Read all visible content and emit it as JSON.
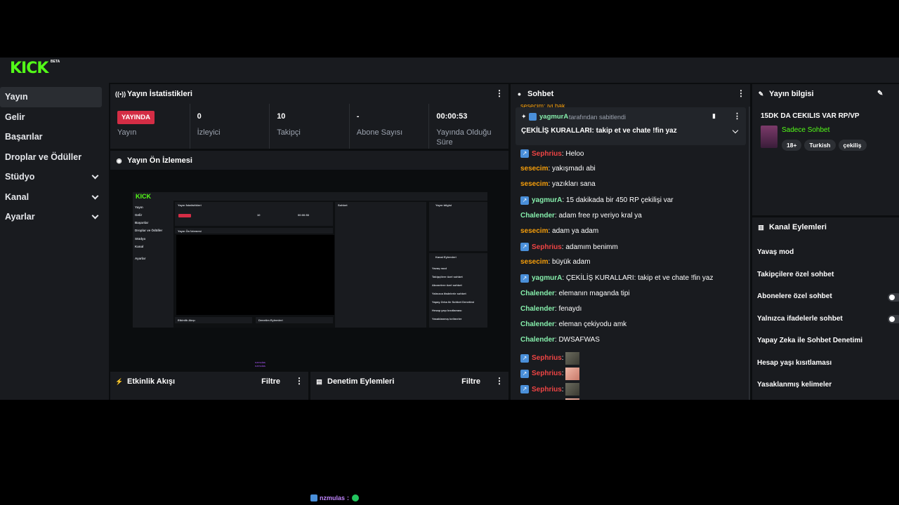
{
  "brand": {
    "logo": "KICK",
    "beta": "BETA"
  },
  "sidebar": {
    "items": [
      {
        "label": "Yayın",
        "active": true,
        "expandable": false
      },
      {
        "label": "Gelir",
        "active": false,
        "expandable": false
      },
      {
        "label": "Başarılar",
        "active": false,
        "expandable": false
      },
      {
        "label": "Droplar ve Ödüller",
        "active": false,
        "expandable": false
      },
      {
        "label": "Stüdyo",
        "active": false,
        "expandable": true
      },
      {
        "label": "Kanal",
        "active": false,
        "expandable": true
      },
      {
        "label": "Ayarlar",
        "active": false,
        "expandable": true
      }
    ]
  },
  "stats_panel": {
    "title": "Yayın İstatistikleri",
    "live_badge": "YAYINDA",
    "stream_label": "Yayın",
    "cells": [
      {
        "value": "0",
        "label": "İzleyici"
      },
      {
        "value": "10",
        "label": "Takipçi"
      },
      {
        "value": "-",
        "label": "Abone Sayısı"
      },
      {
        "value": "00:00:53",
        "label": "Yayında Olduğu Süre"
      }
    ]
  },
  "preview_panel": {
    "title": "Yayın Ön İzlemesi",
    "mini": {
      "logo": "KICK",
      "nav": [
        "Yayın",
        "Gelir",
        "Başarılar",
        "Droplar ve Ödüller",
        "Stüdyo",
        "Kanal",
        "Ayarlar"
      ],
      "stats_title": "Yayın İstatistikleri",
      "chat_title": "Sohbet",
      "info_title": "Yayın bilgisi",
      "preview_title": "Yayın Ön İzlemesi",
      "actions_title": "Kanal Eylemleri",
      "actions": [
        "Yavaş mod",
        "Takipçilere özel sohbet",
        "Abonelere özel sohbet",
        "Yalnızca ifadelerle sohbet",
        "Yapay Zeka ile Sohbet Denetimi",
        "Hesap yaşı kısıtlaması",
        "Yasaklanmış kelimeler"
      ],
      "activity": "Etkinlik Akışı",
      "moderation": "Denetim Eylemleri",
      "filter": "Filtre",
      "badge": "YAYINDA",
      "stat_labels": [
        "Yayın",
        "İzleyici",
        "Takipçi",
        "Abone Sayısı",
        "Yayında Olduğu Süre"
      ],
      "stat_values": [
        "10",
        "00:00:53"
      ],
      "legend": [
        "nzmulas",
        "nzmulas"
      ]
    }
  },
  "activity_panel": {
    "title": "Etkinlik Akışı",
    "filter": "Filtre"
  },
  "moderation_panel": {
    "title": "Denetim Eylemleri",
    "filter": "Filtre"
  },
  "chat": {
    "title": "Sohbet",
    "cut_top": "sesecim: iyi bak",
    "pinned": {
      "user": "yagmurA",
      "note": "tarafından sabitlendi",
      "text": "ÇEKİLİŞ KURALLARI: takip et ve chate !fin yaz"
    },
    "messages": [
      {
        "user": "Sephrius",
        "text": ": Heloo",
        "badge": true,
        "color": "#ef4444"
      },
      {
        "user": "sesecim",
        "text": ": yakışmadı abi",
        "badge": false,
        "color": "#f59e0b"
      },
      {
        "user": "sesecim",
        "text": ": yazıkları sana",
        "badge": false,
        "color": "#f59e0b"
      },
      {
        "user": "yagmurA",
        "text": ": 15 dakikada bir 450 RP çekilişi var",
        "badge": true,
        "color": "#86efac"
      },
      {
        "user": "Chalender",
        "text": ": adam free rp veriyo kral ya",
        "badge": false,
        "color": "#86efac"
      },
      {
        "user": "sesecim",
        "text": ": adam ya adam",
        "badge": false,
        "color": "#f59e0b"
      },
      {
        "user": "Sephrius",
        "text": ": adamım benimm",
        "badge": true,
        "color": "#ef4444"
      },
      {
        "user": "sesecim",
        "text": ": büyük adam",
        "badge": false,
        "color": "#f59e0b"
      },
      {
        "user": "yagmurA",
        "text": ": ÇEKİLİŞ KURALLARI: takip et ve chate !fin yaz",
        "badge": true,
        "color": "#86efac"
      },
      {
        "user": "Chalender",
        "text": ": elemanın maganda tipi",
        "badge": false,
        "color": "#86efac"
      },
      {
        "user": "Chalender",
        "text": ": fenaydı",
        "badge": false,
        "color": "#86efac"
      },
      {
        "user": "Chalender",
        "text": ": eleman çekiyodu amk",
        "badge": false,
        "color": "#86efac"
      },
      {
        "user": "Chalender",
        "text": ": DWSAFWAS",
        "badge": false,
        "color": "#86efac"
      },
      {
        "user": "Sephrius",
        "text": ":",
        "badge": true,
        "color": "#ef4444",
        "emote": "cat-emote"
      },
      {
        "user": "Sephrius",
        "text": ":",
        "badge": true,
        "color": "#ef4444",
        "emote": "hand-emote"
      },
      {
        "user": "Sephrius",
        "text": ":",
        "badge": true,
        "color": "#ef4444",
        "emote": "cat-emote"
      },
      {
        "user": "Sephrius",
        "text": ":",
        "badge": true,
        "color": "#ef4444",
        "emote": "hand-emote"
      }
    ]
  },
  "stream_info": {
    "title": "Yayın bilgisi",
    "stream_title": "15DK DA CEKILIS VAR RP/VP",
    "chat_mode": "Sadece Sohbet",
    "tags": [
      "18+",
      "Turkish",
      "çekiliş"
    ]
  },
  "channel_actions": {
    "title": "Kanal Eylemleri",
    "items": [
      {
        "label": "Yavaş mod",
        "toggle": false
      },
      {
        "label": "Takipçilere özel sohbet",
        "toggle": false
      },
      {
        "label": "Abonelere özel sohbet",
        "toggle": true
      },
      {
        "label": "Yalnızca ifadelerle sohbet",
        "toggle": true
      },
      {
        "label": "Yapay Zeka ile Sohbet Denetimi",
        "toggle": false
      },
      {
        "label": "Hesap yaşı kısıtlaması",
        "toggle": false
      },
      {
        "label": "Yasaklanmış kelimeler",
        "toggle": false
      }
    ]
  },
  "overlay": {
    "user": "nzmulas",
    "separator": ":"
  },
  "colors": {
    "accent": "#53fc18",
    "live": "#d42d45",
    "panel": "#191b1f",
    "background": "#0b0d0f"
  }
}
